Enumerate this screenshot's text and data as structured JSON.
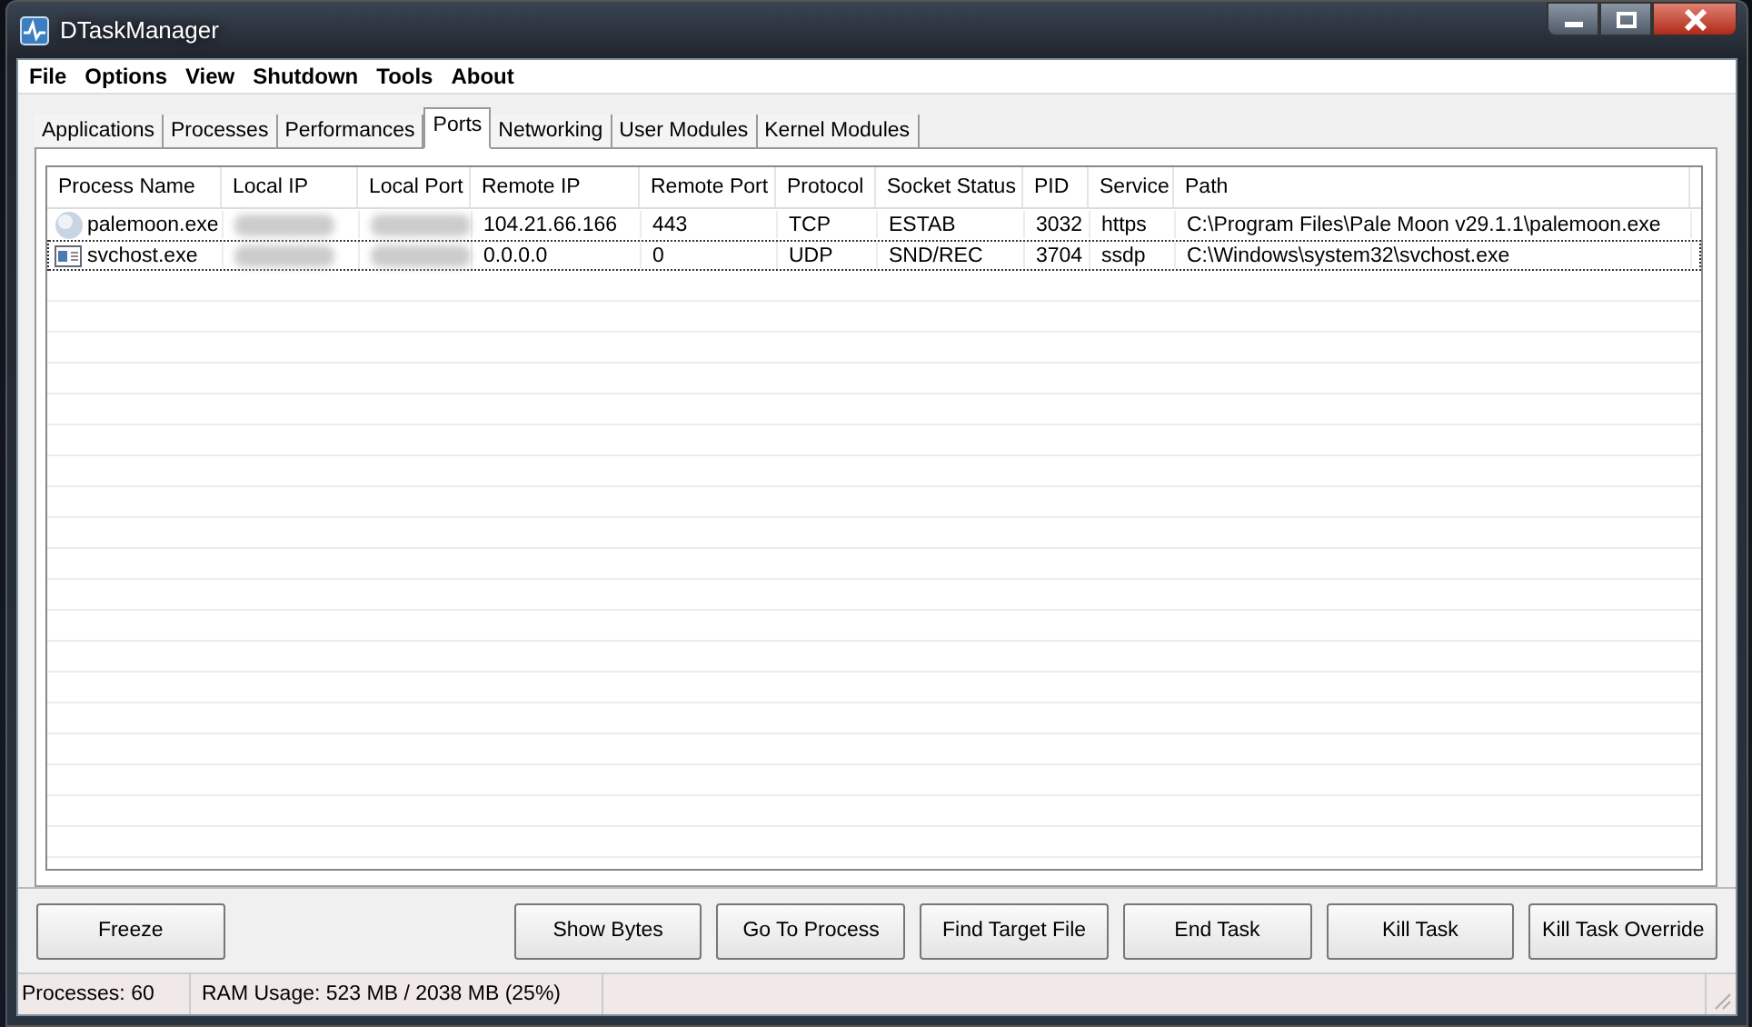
{
  "window": {
    "title": "DTaskManager"
  },
  "menu": [
    "File",
    "Options",
    "View",
    "Shutdown",
    "Tools",
    "About"
  ],
  "tabs": [
    {
      "label": "Applications",
      "selected": false
    },
    {
      "label": "Processes",
      "selected": false
    },
    {
      "label": "Performances",
      "selected": false
    },
    {
      "label": "Ports",
      "selected": true
    },
    {
      "label": "Networking",
      "selected": false
    },
    {
      "label": "User Modules",
      "selected": false
    },
    {
      "label": "Kernel Modules",
      "selected": false
    }
  ],
  "table": {
    "columns": [
      "Process Name",
      "Local IP",
      "Local Port",
      "Remote IP",
      "Remote Port",
      "Protocol",
      "Socket Status",
      "PID",
      "Service",
      "Path"
    ],
    "rows": [
      {
        "kind": "globe",
        "focused": false,
        "cells": [
          "palemoon.exe",
          "",
          "",
          "104.21.66.166",
          "443",
          "TCP",
          "ESTAB",
          "3032",
          "https",
          "C:\\Program Files\\Pale Moon v29.1.1\\palemoon.exe"
        ]
      },
      {
        "kind": "window",
        "focused": true,
        "cells": [
          "svchost.exe",
          "",
          "",
          "0.0.0.0",
          "0",
          "UDP",
          "SND/REC",
          "3704",
          "ssdp",
          "C:\\Windows\\system32\\svchost.exe"
        ]
      }
    ]
  },
  "buttons": [
    "Freeze",
    "Show Bytes",
    "Go To Process",
    "Find Target File",
    "End Task",
    "Kill Task",
    "Kill Task Override"
  ],
  "status_bar": [
    "Processes: 60",
    "RAM Usage:  523 MB / 2038 MB (25%)"
  ]
}
